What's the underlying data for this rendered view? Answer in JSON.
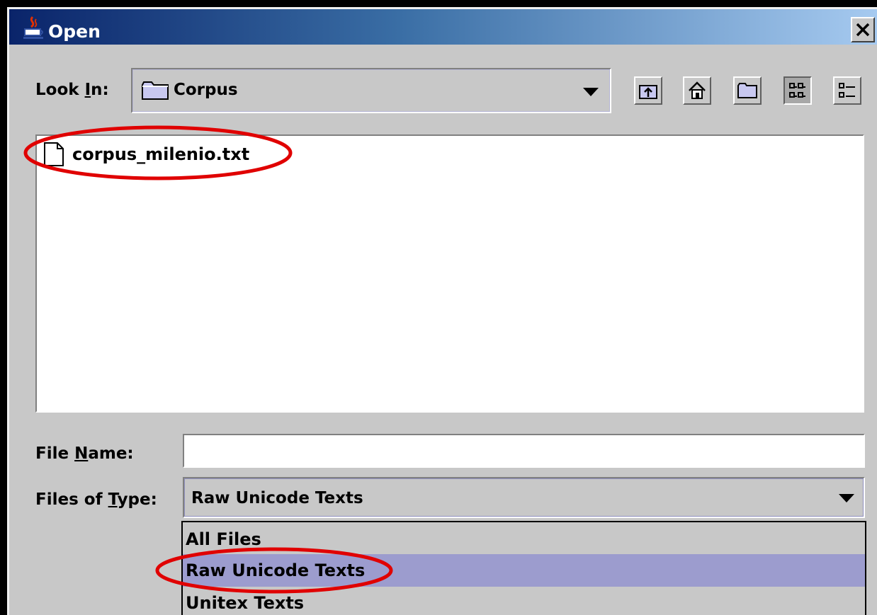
{
  "dialog": {
    "title": "Open",
    "close_label": "X"
  },
  "look_in": {
    "label_pre": "Look ",
    "label_mnemonic": "I",
    "label_post": "n:",
    "value": "Corpus"
  },
  "toolbar": {
    "icons": [
      "up-one-level-icon",
      "home-icon",
      "new-folder-icon",
      "list-view-icon",
      "details-view-icon"
    ]
  },
  "files": [
    {
      "name": "corpus_milenio.txt",
      "icon": "file-icon"
    }
  ],
  "file_name": {
    "label_pre": "File ",
    "label_mnemonic": "N",
    "label_post": "ame:",
    "value": ""
  },
  "files_of_type": {
    "label_pre": "Files of ",
    "label_mnemonic": "T",
    "label_post": "ype:",
    "value": "Raw Unicode Texts",
    "options": [
      "All Files",
      "Raw Unicode Texts",
      "Unitex Texts"
    ],
    "selected_index": 1
  },
  "colors": {
    "selection": "#9c9cce",
    "annotation": "#e00000",
    "title_start": "#0a246a",
    "title_end": "#a6caf0"
  }
}
